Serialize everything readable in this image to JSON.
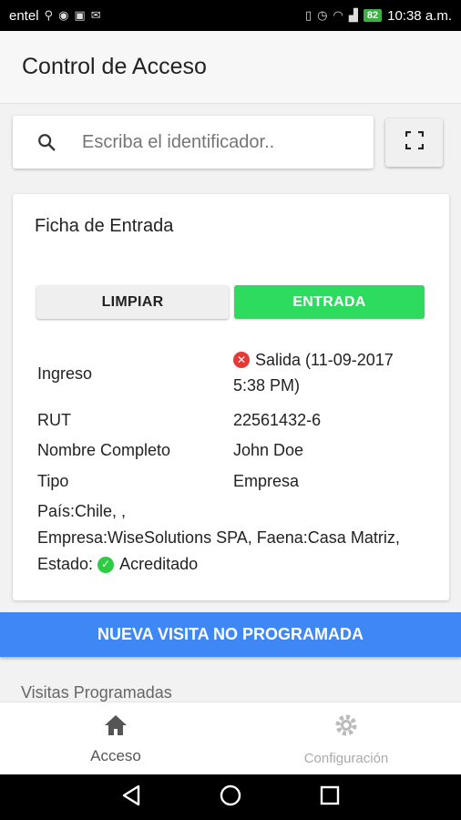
{
  "status_bar": {
    "carrier": "entel",
    "battery": "82",
    "time": "10:38 a.m."
  },
  "app_bar": {
    "title": "Control de Acceso"
  },
  "search": {
    "placeholder": "Escriba el identificador.."
  },
  "card": {
    "title": "Ficha de Entrada",
    "clear_label": "LIMPIAR",
    "entry_label": "ENTRADA",
    "rows": [
      {
        "label": "Ingreso",
        "value": "Salida (11-09-2017 5:38 PM)",
        "status": "exit"
      },
      {
        "label": "RUT",
        "value": "22561432-6"
      },
      {
        "label": "Nombre Completo",
        "value": "John Doe"
      },
      {
        "label": "Tipo",
        "value": "Empresa"
      }
    ],
    "details_line1": "País:Chile, ,",
    "details_line2": "Empresa:WiseSolutions SPA, Faena:Casa Matriz,",
    "estado_label": "Estado:",
    "estado_value": "Acreditado"
  },
  "new_visit_label": "NUEVA VISITA NO PROGRAMADA",
  "section_label": "Visitas Programadas",
  "bottom_nav": {
    "access_label": "Acceso",
    "config_label": "Configuración"
  },
  "colors": {
    "accent_blue": "#3f87f5",
    "entry_green": "#2ddb5f",
    "exit_red": "#e53935",
    "ok_green": "#2ecc40"
  },
  "icons": {
    "search": "search-icon",
    "scan": "fullscreen-scan-icon",
    "home": "home-icon",
    "settings": "gear-icon",
    "back": "back-triangle-icon",
    "home_sys": "home-circle-icon",
    "recents": "recents-square-icon"
  }
}
